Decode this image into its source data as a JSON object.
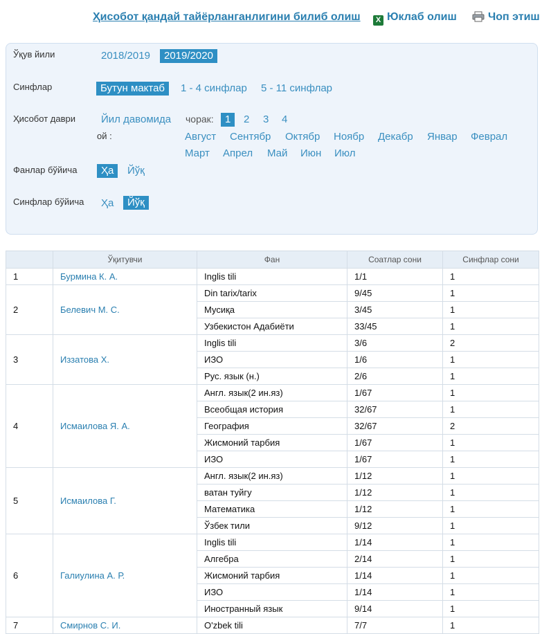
{
  "header": {
    "report_link": "Ҳисобот қандай тайёрланганлигини билиб олиш",
    "download": "Юклаб олиш",
    "print": "Чоп этиш"
  },
  "filters": {
    "year_label": "Ўқув йили",
    "years": [
      "2018/2019",
      "2019/2020"
    ],
    "classes_label": "Синфлар",
    "classes": [
      "Бутун мактаб",
      "1 - 4 синфлар",
      "5 - 11 синфлар"
    ],
    "period_label": "Ҳисобот даври",
    "period_all_year": "Йил давомида",
    "quarter_label": "чорак:",
    "quarters": [
      "1",
      "2",
      "3",
      "4"
    ],
    "month_label": "ой :",
    "months_row1": [
      "Август",
      "Сентябр",
      "Октябр",
      "Ноябр",
      "Декабр",
      "Январ",
      "Феврал"
    ],
    "months_row2": [
      "Март",
      "Апрел",
      "Май",
      "Июн",
      "Июл"
    ],
    "by_subject_label": "Фанлар бўйича",
    "by_subject_opts": [
      "Ҳа",
      "Йўқ"
    ],
    "by_class_label": "Синфлар бўйича",
    "by_class_opts": [
      "Ҳа",
      "Йўқ"
    ]
  },
  "table": {
    "headers": [
      "",
      "Ўқитувчи",
      "Фан",
      "Соатлар сони",
      "Синфлар сони"
    ],
    "teachers": [
      {
        "num": "1",
        "name": "Бурмина К. А.",
        "rows": [
          [
            "Inglis tili",
            "1/1",
            "1"
          ]
        ]
      },
      {
        "num": "2",
        "name": "Белевич М. С.",
        "rows": [
          [
            "Din tarix/tarix",
            "9/45",
            "1"
          ],
          [
            "Мусиқа",
            "3/45",
            "1"
          ],
          [
            "Узбекистон Адабиёти",
            "33/45",
            "1"
          ]
        ]
      },
      {
        "num": "3",
        "name": "Иззатова Х.",
        "rows": [
          [
            "Inglis tili",
            "3/6",
            "2"
          ],
          [
            "ИЗО",
            "1/6",
            "1"
          ],
          [
            "Рус. язык (н.)",
            "2/6",
            "1"
          ]
        ]
      },
      {
        "num": "4",
        "name": "Исмаилова Я. А.",
        "rows": [
          [
            "Англ. язык(2 ин.яз)",
            "1/67",
            "1"
          ],
          [
            "Всеобщая история",
            "32/67",
            "1"
          ],
          [
            "География",
            "32/67",
            "2"
          ],
          [
            "Жисмоний тарбия",
            "1/67",
            "1"
          ],
          [
            "ИЗО",
            "1/67",
            "1"
          ]
        ]
      },
      {
        "num": "5",
        "name": "Исмаилова Г.",
        "rows": [
          [
            "Англ. язык(2 ин.яз)",
            "1/12",
            "1"
          ],
          [
            "ватан туйгу",
            "1/12",
            "1"
          ],
          [
            "Математика",
            "1/12",
            "1"
          ],
          [
            "Ўзбек тили",
            "9/12",
            "1"
          ]
        ]
      },
      {
        "num": "6",
        "name": "Галиулина А. Р.",
        "rows": [
          [
            "Inglis tili",
            "1/14",
            "1"
          ],
          [
            "Алгебра",
            "2/14",
            "1"
          ],
          [
            "Жисмоний тарбия",
            "1/14",
            "1"
          ],
          [
            "ИЗО",
            "1/14",
            "1"
          ],
          [
            "Иностранный язык",
            "9/14",
            "1"
          ]
        ]
      },
      {
        "num": "7",
        "name": "Смирнов С. И.",
        "rows": [
          [
            "O'zbek tili",
            "7/7",
            "1"
          ]
        ]
      }
    ]
  }
}
